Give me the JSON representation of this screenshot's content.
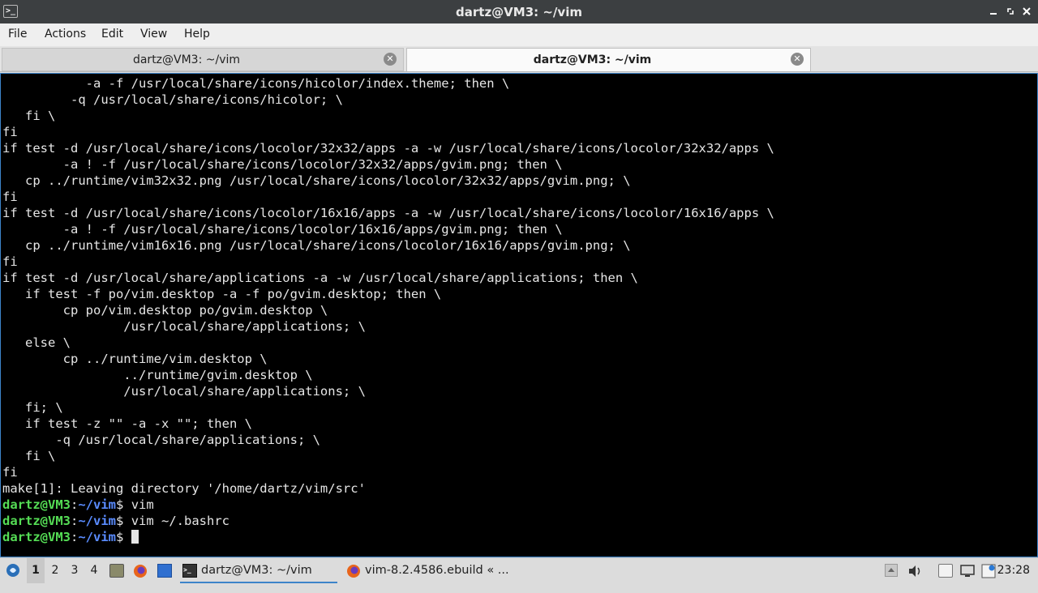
{
  "window": {
    "title": "dartz@VM3: ~/vim",
    "app_icon": ">_",
    "minimize_icon": "minimize-icon",
    "maximize_icon": "maximize-icon",
    "close_icon": "close-icon"
  },
  "menu": [
    "File",
    "Actions",
    "Edit",
    "View",
    "Help"
  ],
  "tabs": [
    {
      "label": "dartz@VM3: ~/vim",
      "active": false
    },
    {
      "label": "dartz@VM3: ~/vim",
      "active": true
    }
  ],
  "terminal": {
    "output_lines": [
      "           -a -f /usr/local/share/icons/hicolor/index.theme; then \\",
      "         -q /usr/local/share/icons/hicolor; \\",
      "   fi \\",
      "fi",
      "if test -d /usr/local/share/icons/locolor/32x32/apps -a -w /usr/local/share/icons/locolor/32x32/apps \\",
      "        -a ! -f /usr/local/share/icons/locolor/32x32/apps/gvim.png; then \\",
      "   cp ../runtime/vim32x32.png /usr/local/share/icons/locolor/32x32/apps/gvim.png; \\",
      "fi",
      "if test -d /usr/local/share/icons/locolor/16x16/apps -a -w /usr/local/share/icons/locolor/16x16/apps \\",
      "        -a ! -f /usr/local/share/icons/locolor/16x16/apps/gvim.png; then \\",
      "   cp ../runtime/vim16x16.png /usr/local/share/icons/locolor/16x16/apps/gvim.png; \\",
      "fi",
      "if test -d /usr/local/share/applications -a -w /usr/local/share/applications; then \\",
      "   if test -f po/vim.desktop -a -f po/gvim.desktop; then \\",
      "        cp po/vim.desktop po/gvim.desktop \\",
      "                /usr/local/share/applications; \\",
      "   else \\",
      "        cp ../runtime/vim.desktop \\",
      "                ../runtime/gvim.desktop \\",
      "                /usr/local/share/applications; \\",
      "   fi; \\",
      "   if test -z \"\" -a -x \"\"; then \\",
      "       -q /usr/local/share/applications; \\",
      "   fi \\",
      "fi",
      "make[1]: Leaving directory '/home/dartz/vim/src'"
    ],
    "prompt_user": "dartz@VM3",
    "prompt_sep": ":",
    "prompt_path": "~/vim",
    "prompt_end": "$ ",
    "commands": [
      "vim",
      "vim ~/.bashrc",
      ""
    ]
  },
  "taskbar": {
    "start_icon": "lxqt-start-icon",
    "desktops": [
      "1",
      "2",
      "3",
      "4"
    ],
    "active_desktop": "1",
    "launchers": [
      "file-manager-icon",
      "firefox-icon",
      "desktop-icon"
    ],
    "tasks": [
      {
        "icon": "terminal-icon",
        "label": "dartz@VM3: ~/vim",
        "active": true
      },
      {
        "icon": "firefox-icon",
        "label": "vim-8.2.4586.ebuild « ...",
        "active": false
      }
    ],
    "tray_icons": [
      "tray-up-arrow-icon",
      "volume-icon",
      "clipboard-icon",
      "network-icon",
      "update-notifier-icon"
    ],
    "clock": "23:28"
  },
  "colors": {
    "titlebar": "#3c3f41",
    "terminal_bg": "#000000",
    "terminal_fg": "#e6e6e6",
    "prompt_user": "#55dd55",
    "prompt_path": "#5a8cff",
    "accent": "#3d84c9"
  }
}
